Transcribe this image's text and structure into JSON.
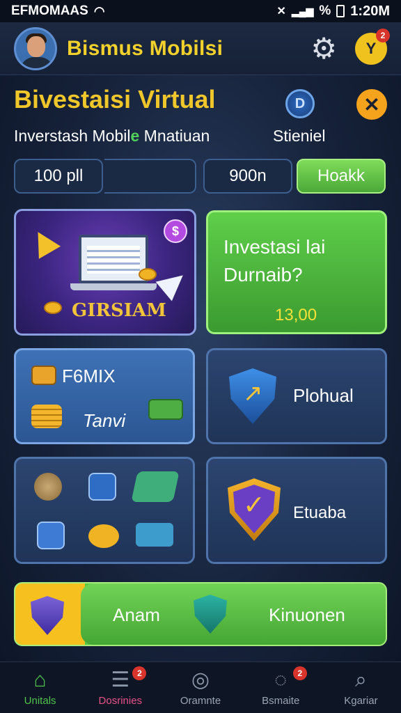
{
  "status_bar": {
    "carrier": "EFMOMAAS",
    "battery": "%",
    "time": "1:20M"
  },
  "header": {
    "app_title": "Bismus Mobilsi",
    "profile_letter": "Y",
    "profile_badge": "2"
  },
  "hero": {
    "title": "Bivestaisi Virtual",
    "coin_symbol": "D",
    "subtitle_start": "Inverstash Mobil",
    "subtitle_accent": "e",
    "subtitle_end": " Mnatiuan",
    "subtitle_right": "Stieniel"
  },
  "inputs": {
    "amount_value": "100 pll",
    "second_value": "900n",
    "action_label": "Hoakk"
  },
  "cards": {
    "promo_label": "GIRSIAM",
    "promo_badge": "$",
    "invest_question_line1": "Investasi lai",
    "invest_question_line2": "Durnaib?",
    "invest_price": "13,00",
    "fomix_label": "F6MIX",
    "fomix_sub": "Tanvi",
    "plohual_label": "Plohual",
    "etuaba_label": "Etuaba"
  },
  "banner": {
    "left_label": "Anam",
    "right_label": "Kinuonen"
  },
  "bottom_nav": [
    {
      "label": "Unitals",
      "icon": "home-icon",
      "glyph": "⌂"
    },
    {
      "label": "Dosrinies",
      "icon": "list-icon",
      "glyph": "☰",
      "badge": "2"
    },
    {
      "label": "Oramnte",
      "icon": "compass-icon",
      "glyph": "◎"
    },
    {
      "label": "Bsmaite",
      "icon": "bell-icon",
      "glyph": "◌",
      "badge": "2"
    },
    {
      "label": "Kgariar",
      "icon": "search-icon",
      "glyph": "⌕"
    }
  ],
  "colors": {
    "accent_yellow": "#f2d12c",
    "accent_green": "#4fc34a",
    "badge_red": "#d9342b"
  }
}
